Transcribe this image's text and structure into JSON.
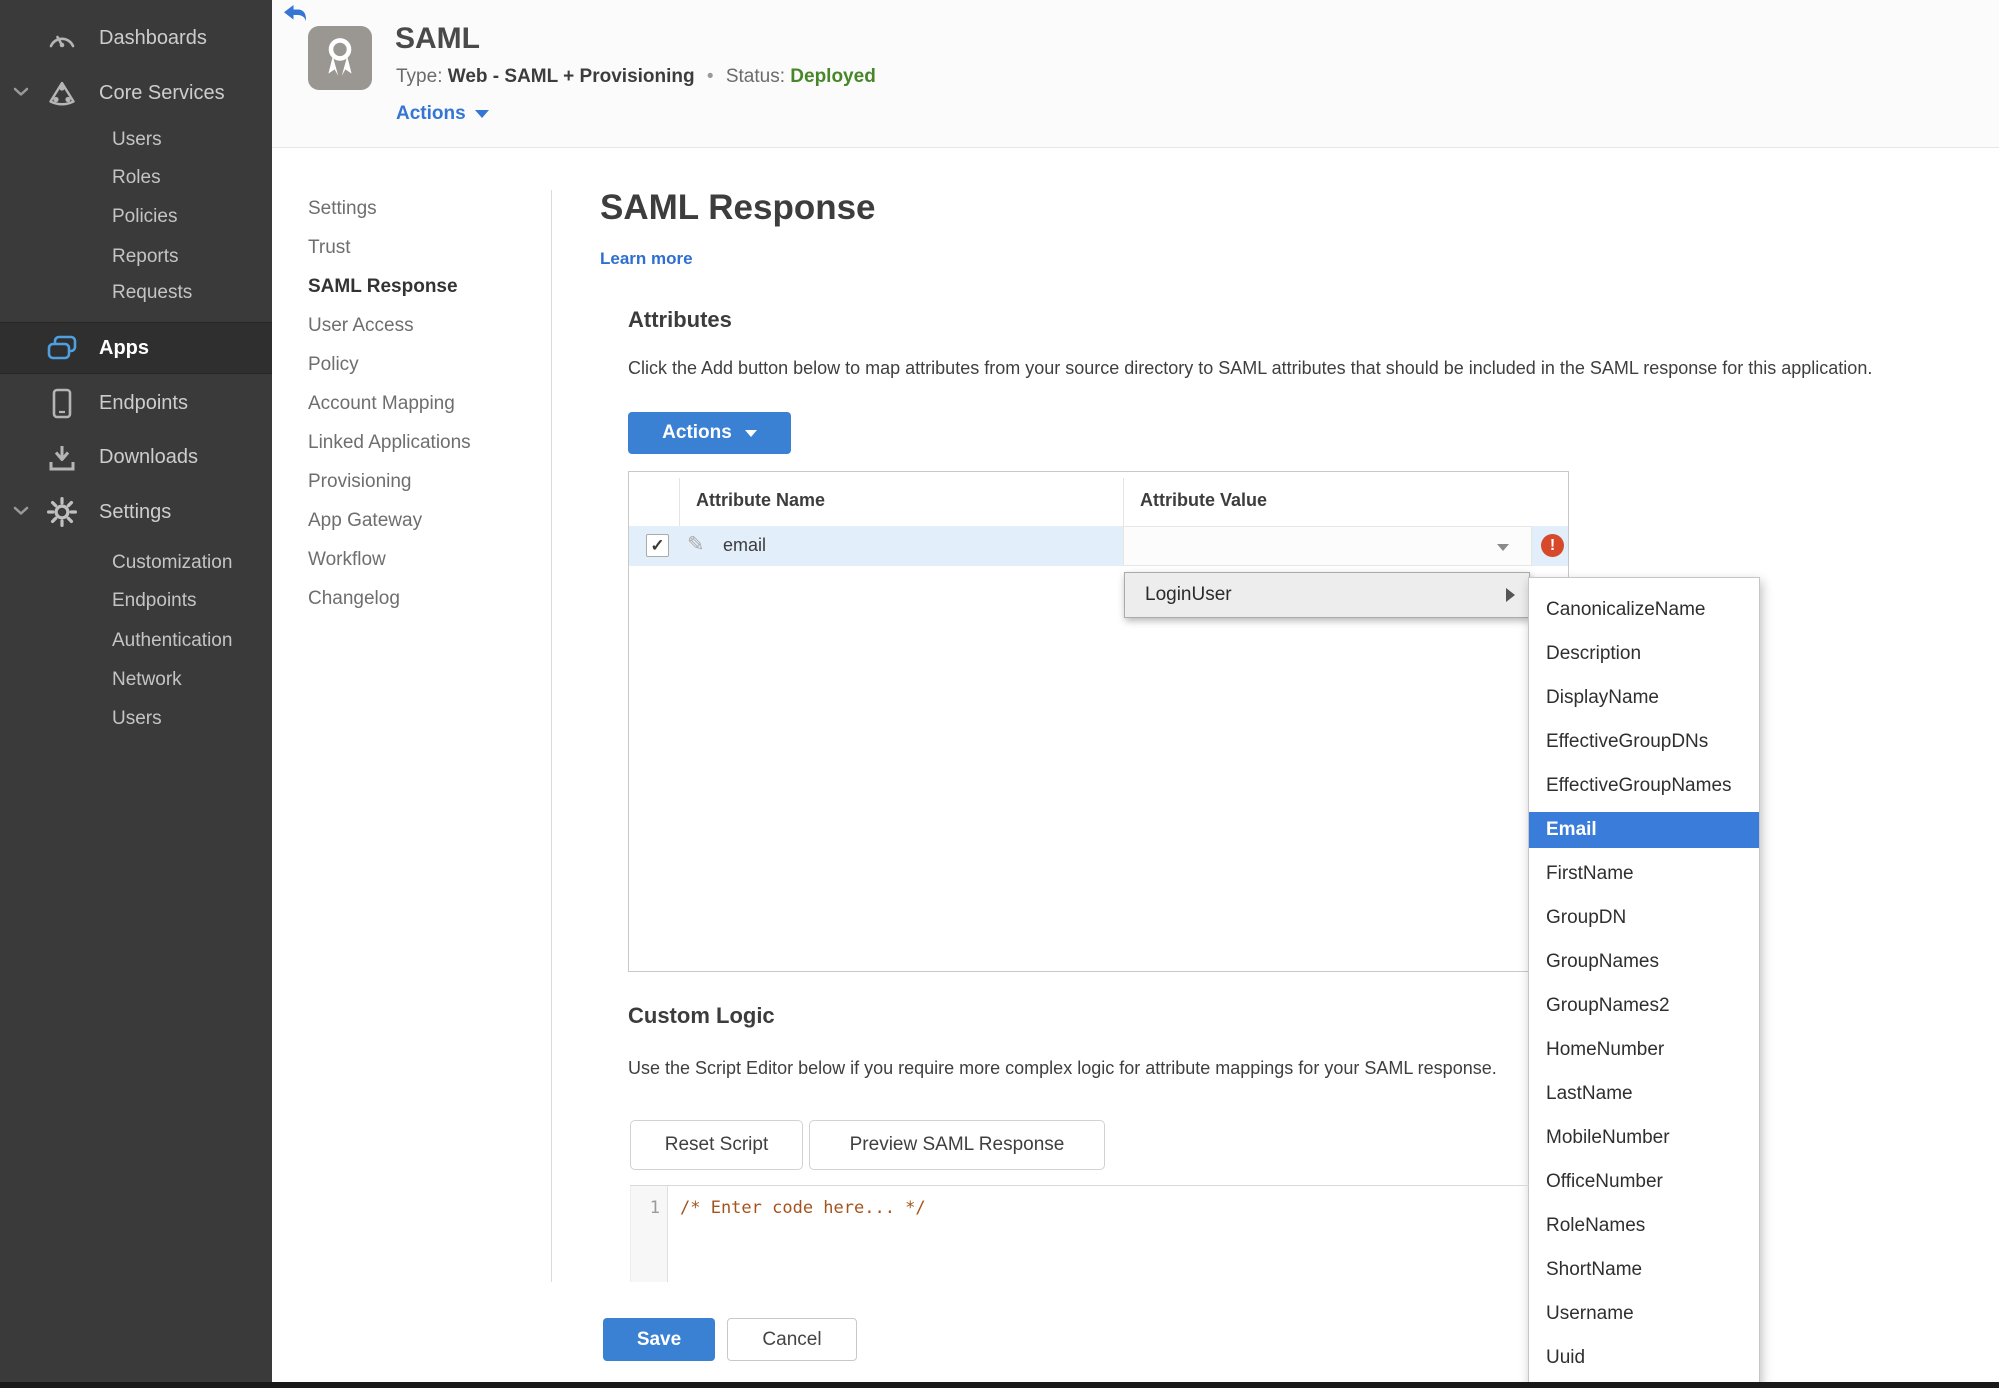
{
  "colors": {
    "accent_blue": "#3a80d3",
    "link_blue": "#2e6fd0",
    "menu_select_blue": "#3a7cd9",
    "status_green": "#47872a",
    "error_red": "#d6492b",
    "sidebar_bg": "#3a3a3a",
    "apps_icon_blue": "#4ea0e0"
  },
  "sidebar": {
    "items": [
      {
        "label": "Dashboards"
      },
      {
        "label": "Core Services"
      },
      {
        "label": "Users"
      },
      {
        "label": "Roles"
      },
      {
        "label": "Policies"
      },
      {
        "label": "Reports"
      },
      {
        "label": "Requests"
      },
      {
        "label": "Apps"
      },
      {
        "label": "Endpoints"
      },
      {
        "label": "Downloads"
      },
      {
        "label": "Settings"
      },
      {
        "label": "Customization"
      },
      {
        "label": "Endpoints"
      },
      {
        "label": "Authentication"
      },
      {
        "label": "Network"
      },
      {
        "label": "Users"
      }
    ]
  },
  "header": {
    "title": "SAML",
    "type_label": "Type:",
    "type_value": "Web - SAML + Provisioning",
    "separator": "•",
    "status_label": "Status:",
    "status_value": "Deployed",
    "actions_label": "Actions"
  },
  "subnav": {
    "items": [
      "Settings",
      "Trust",
      "SAML Response",
      "User Access",
      "Policy",
      "Account Mapping",
      "Linked Applications",
      "Provisioning",
      "App Gateway",
      "Workflow",
      "Changelog"
    ],
    "active": "SAML Response"
  },
  "main": {
    "title": "SAML Response",
    "learn_more": "Learn more",
    "attributes": {
      "heading": "Attributes",
      "description": "Click the Add button below to map attributes from your source directory to SAML attributes that should be included in the SAML response for this application.",
      "actions_button": "Actions",
      "table": {
        "columns": [
          "Attribute Name",
          "Attribute Value"
        ],
        "row": {
          "checked_glyph": "✓",
          "pencil_glyph": "✎",
          "name": "email",
          "value": "",
          "error_glyph": "!"
        }
      }
    },
    "dropdown": {
      "parent": "LoginUser",
      "selected": "Email",
      "options": [
        "CanonicalizeName",
        "Description",
        "DisplayName",
        "EffectiveGroupDNs",
        "EffectiveGroupNames",
        "Email",
        "FirstName",
        "GroupDN",
        "GroupNames",
        "GroupNames2",
        "HomeNumber",
        "LastName",
        "MobileNumber",
        "OfficeNumber",
        "RoleNames",
        "ShortName",
        "Username",
        "Uuid"
      ]
    },
    "custom_logic": {
      "heading": "Custom Logic",
      "description": "Use the Script Editor below if you require more complex logic for attribute mappings for your SAML response.",
      "reset_button": "Reset Script",
      "preview_button": "Preview SAML Response",
      "editor": {
        "line_number": "1",
        "code": "/* Enter code here... */"
      }
    },
    "footer": {
      "save": "Save",
      "cancel": "Cancel"
    }
  }
}
